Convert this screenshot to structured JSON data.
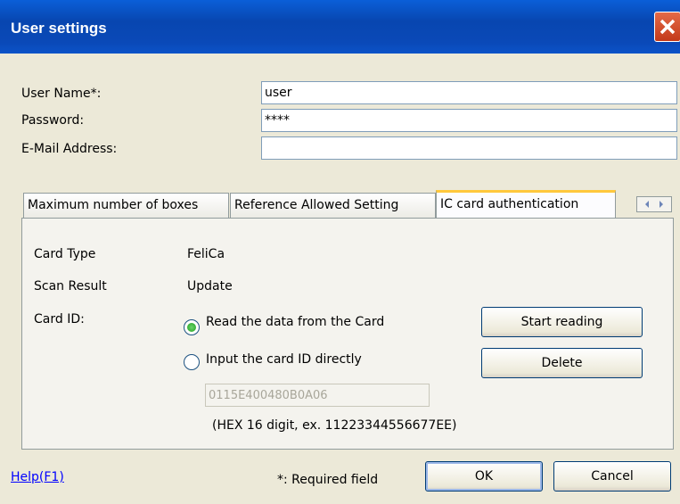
{
  "window": {
    "title": "User settings"
  },
  "form": {
    "username_label": "User Name*:",
    "username_value": "user",
    "password_label": "Password:",
    "password_value": "****",
    "email_label": "E-Mail Address:",
    "email_value": ""
  },
  "tabs": [
    {
      "label": "Maximum number of boxes"
    },
    {
      "label": "Reference Allowed Setting"
    },
    {
      "label": "IC card authentication"
    }
  ],
  "ic_card": {
    "card_type_label": "Card Type",
    "card_type_value": "FeliCa",
    "scan_result_label": "Scan Result",
    "scan_result_value": "Update",
    "card_id_label": "Card ID:",
    "radio_read_label": "Read the data from the Card",
    "radio_input_label": "Input the card ID directly",
    "start_reading_label": "Start reading",
    "delete_label": "Delete",
    "card_id_value": "0115E400480B0A06",
    "hint": "(HEX 16 digit, ex. 11223344556677EE)"
  },
  "footer": {
    "help_label": "Help(F1)",
    "required_note": "*: Required field",
    "ok_label": "OK",
    "cancel_label": "Cancel"
  },
  "colors": {
    "title_bar": "#0a4fc4",
    "close": "#d44a27",
    "tab_highlight": "#ffc83c",
    "radio_selected": "#21a121"
  }
}
